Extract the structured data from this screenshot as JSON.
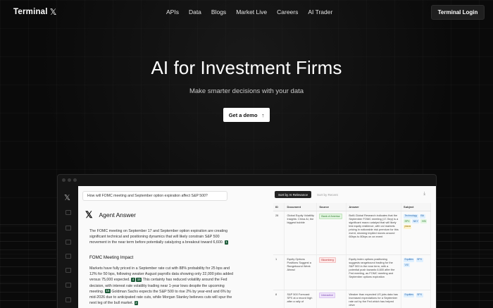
{
  "nav": {
    "logo_text": "Terminal",
    "logo_mark": "𝕏",
    "links": [
      "APIs",
      "Data",
      "Blogs",
      "Market Live",
      "Careers",
      "AI Trader"
    ],
    "login_label": "Terminal Login"
  },
  "hero": {
    "title": "AI for Investment Firms",
    "subtitle": "Make smarter decisions with your data",
    "cta_label": "Get a demo",
    "cta_icon": "↑"
  },
  "app": {
    "query": "How will FOMC meeting and September option expiration affect S&P 500?",
    "agent_logo": "𝕏",
    "agent_title": "Agent Answer",
    "paragraph1": "The FOMC meeting on September 17 and September option expiration are creating significant technical and positioning dynamics that will likely constrain S&P 500 movement in the near term before potentially catalyzing a breakout toward 6,600.",
    "cite1": "1",
    "section_title": "FOMC Meeting Impact",
    "paragraph2a": "Markets have fully priced in a September rate cut with 88% probability for 25 bps and 12% for 50 bps, following weaker August payrolls data showing only 22,000 jobs added versus 75,000 expected.",
    "cite2": "4",
    "cite3": "15",
    "paragraph2b": "This certainty has reduced volatility around the Fed decision, with interest rate volatility trading near 1-year lows despite the upcoming meeting.",
    "cite4": "15",
    "paragraph2c": "Goldman Sachs expects the S&P 500 to rise 2% by year-end and 6% by mid-2026 due to anticipated rate cuts, while Morgan Stanley believes cuts will spur the next leg of the bull market.",
    "cite5": "2",
    "sort_active": "Sort by AI Relevance",
    "sort_other": "Sort by Recent",
    "download_icon": "⤓",
    "table": {
      "headers": [
        "ID",
        "Document",
        "Source",
        "Answer",
        "Subject"
      ],
      "rows": [
        {
          "id": "28",
          "document": "Global Equity Volatility Insights: China AI, the biggest bubble",
          "source": "Bank of America",
          "answer": "BofA Global Research indicates that the September FOMC meeting (17-Sep) is a significant macro catalyst that will likely test equity resilience, with vol markets pricing in noticeable risk premium for this event, showing implied moves around 60bps to 80bps on an event",
          "subjects": [
            "Technology",
            "BA",
            "SPX",
            "NKY",
            "HSI",
            "plaza"
          ]
        },
        {
          "id": "1",
          "document": "Equity Options Positions Suggest a Rangebound Week Ahead",
          "source": "Bloomberg",
          "answer": "Equity index options positioning suggests rangebound trading for the S&P 500 in the near term, with a potential push towards 6,600 after the Fed meeting, as FOMC meeting and September options expiration",
          "subjects": [
            "Equities",
            "SPX",
            "VIX"
          ]
        },
        {
          "id": "8",
          "document": "S&P 500 Forecast: SPX at a record high after a rally of",
          "source": "Interactive",
          "answer": "Weaker than expected US jobs data has increased expectations for a September rate cut by the Fed which has helped drive",
          "subjects": [
            "Equities",
            "SPX"
          ]
        }
      ]
    }
  }
}
